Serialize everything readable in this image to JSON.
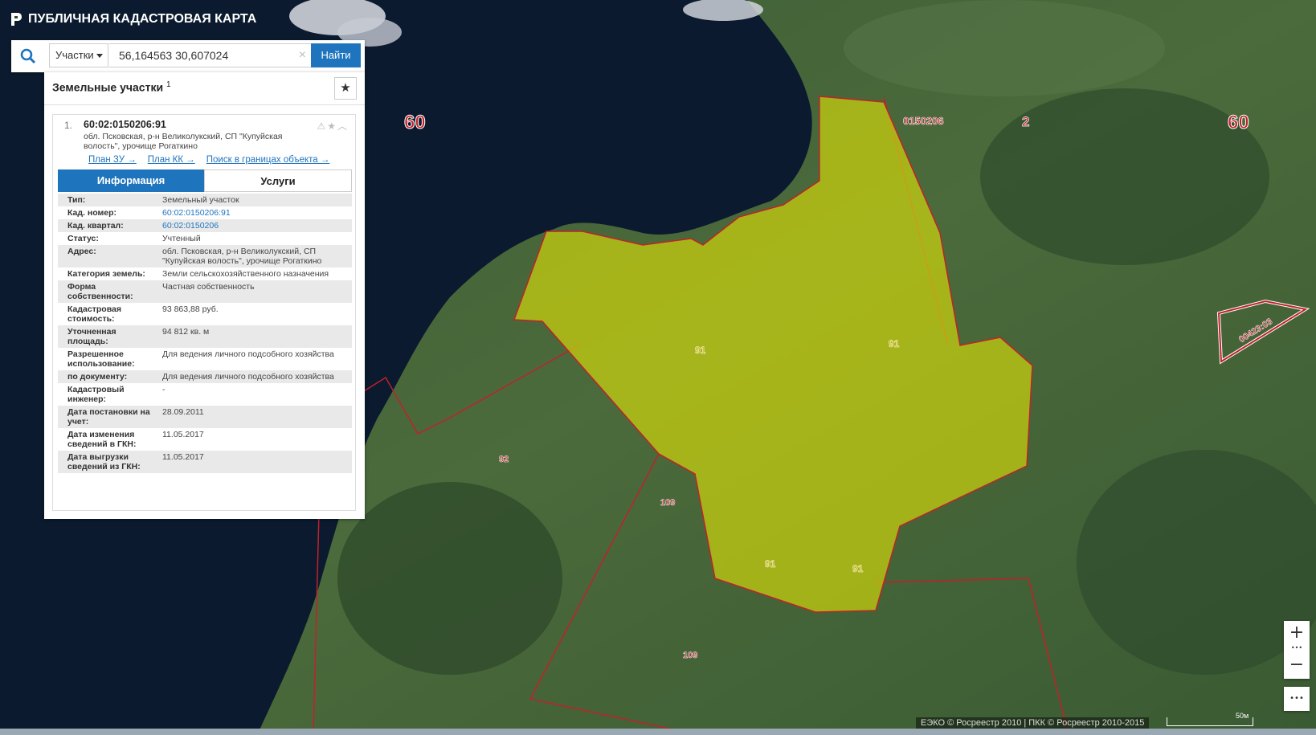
{
  "app": {
    "title": "ПУБЛИЧНАЯ КАДАСТРОВАЯ КАРТА"
  },
  "search": {
    "type_label": "Участки",
    "query": "56,164563 30,607024",
    "find_label": "Найти",
    "clear_symbol": "×"
  },
  "panel": {
    "title": "Земельные участки",
    "count": "1",
    "result": {
      "index": "1.",
      "cad_number": "60:02:0150206:91",
      "address": "обл. Псковская, р-н Великолукский, СП \"Купуйская волость\", урочище Рогаткино",
      "links": [
        "План ЗУ →",
        "План КК →",
        "Поиск в границах объекта →"
      ],
      "tabs": {
        "info": "Информация",
        "services": "Услуги"
      },
      "properties": [
        {
          "key": "Тип:",
          "value": "Земельный участок"
        },
        {
          "key": "Кад. номер:",
          "value": "60:02:0150206:91"
        },
        {
          "key": "Кад. квартал:",
          "value": "60:02:0150206"
        },
        {
          "key": "Статус:",
          "value": "Учтенный"
        },
        {
          "key": "Адрес:",
          "value": "обл. Псковская, р-н Великолукский, СП \"Купуйская волость\", урочище Рогаткино"
        },
        {
          "key": "Категория земель:",
          "value": "Земли сельскохозяйственного назначения"
        },
        {
          "key": "Форма собственности:",
          "value": "Частная собственность"
        },
        {
          "key": "Кадастровая стоимость:",
          "value": "93 863,88 руб."
        },
        {
          "key": "Уточненная площадь:",
          "value": "94 812 кв. м"
        },
        {
          "key": "Разрешенное использование:",
          "value": "Для ведения личного подсобного хозяйства"
        },
        {
          "key": "по документу:",
          "value": "Для ведения личного подсобного хозяйства"
        },
        {
          "key": "Кадастровый инженер:",
          "value": "-"
        },
        {
          "key": "Дата постановки на учет:",
          "value": "28.09.2011"
        },
        {
          "key": "Дата изменения сведений в ГКН:",
          "value": "11.05.2017"
        },
        {
          "key": "Дата выгрузки сведений из ГКН:",
          "value": "11.05.2017"
        }
      ]
    }
  },
  "map": {
    "labels": {
      "region_left": "60",
      "region_right": "60",
      "quarter": "0150206",
      "district": "2",
      "parcel_91": "91",
      "parcel_92": "92",
      "parcel_109": "109",
      "parcel_other": "00423:03"
    },
    "colors": {
      "highlight_fill": "#f2f200",
      "boundary": "#c0222a",
      "water": "#0b1a2e"
    }
  },
  "controls": {
    "zoom_in": "+",
    "zoom_out": "−",
    "more": "•••"
  },
  "footer": {
    "copyright": "ЕЭКО © Росреестр 2010 | ПКК © Росреестр 2010-2015",
    "scale": "50м"
  }
}
